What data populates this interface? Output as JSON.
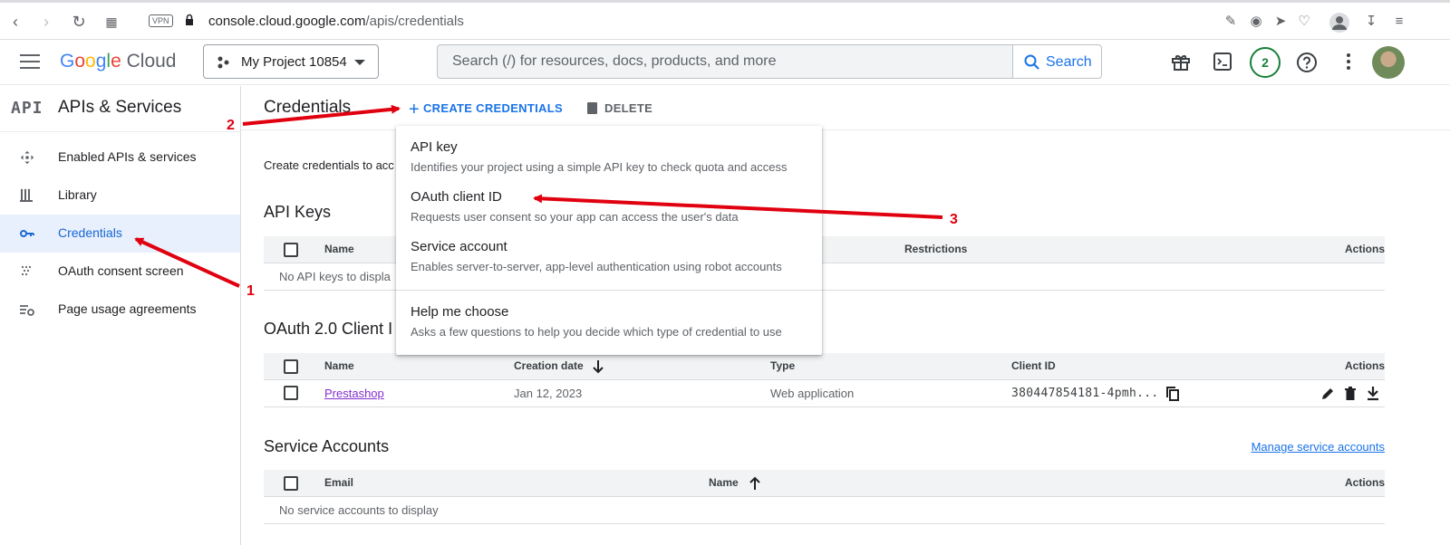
{
  "browser": {
    "vpn_label": "VPN",
    "url_domain": "console.cloud.google.com",
    "url_path": "/apis/credentials"
  },
  "header": {
    "logo_letters": [
      "G",
      "o",
      "o",
      "g",
      "l",
      "e"
    ],
    "logo_product": "Cloud",
    "project_name": "My Project 10854",
    "search_placeholder": "Search (/) for resources, docs, products, and more",
    "search_button": "Search",
    "notification_count": "2"
  },
  "sidebar": {
    "api_glyph": "API",
    "title": "APIs & Services",
    "items": [
      {
        "label": "Enabled APIs & services",
        "icon": "move-icon"
      },
      {
        "label": "Library",
        "icon": "library-icon"
      },
      {
        "label": "Credentials",
        "icon": "key-icon",
        "active": true
      },
      {
        "label": "OAuth consent screen",
        "icon": "consent-icon"
      },
      {
        "label": "Page usage agreements",
        "icon": "settings-list-icon"
      }
    ]
  },
  "toolbar": {
    "title": "Credentials",
    "create_label": "CREATE CREDENTIALS",
    "delete_label": "DELETE"
  },
  "intro_text": "Create credentials to acc",
  "api_keys": {
    "title": "API Keys",
    "columns": [
      "Name",
      "Restrictions",
      "Actions"
    ],
    "empty_text": "No API keys to displa"
  },
  "oauth": {
    "title": "OAuth 2.0 Client I",
    "columns": [
      "Name",
      "Creation date",
      "Type",
      "Client ID",
      "Actions"
    ],
    "rows": [
      {
        "name": "Prestashop",
        "date": "Jan 12, 2023",
        "type": "Web application",
        "client_id": "380447854181-4pmh..."
      }
    ]
  },
  "service_accounts": {
    "title": "Service Accounts",
    "manage_link": "Manage service accounts",
    "columns": [
      "Email",
      "Name",
      "Actions"
    ],
    "empty_text": "No service accounts to display"
  },
  "dropdown": {
    "items": [
      {
        "title": "API key",
        "subtitle": "Identifies your project using a simple API key to check quota and access"
      },
      {
        "title": "OAuth client ID",
        "subtitle": "Requests user consent so your app can access the user's data"
      },
      {
        "title": "Service account",
        "subtitle": "Enables server-to-server, app-level authentication using robot accounts"
      },
      {
        "title": "Help me choose",
        "subtitle": "Asks a few questions to help you decide which type of credential to use"
      }
    ]
  },
  "annotations": [
    "1",
    "2",
    "3"
  ],
  "colors": {
    "accent": "#1a73e8",
    "active_bg": "#e8f0fe",
    "annotation": "#e0000f",
    "link_visited": "#8430ce"
  }
}
